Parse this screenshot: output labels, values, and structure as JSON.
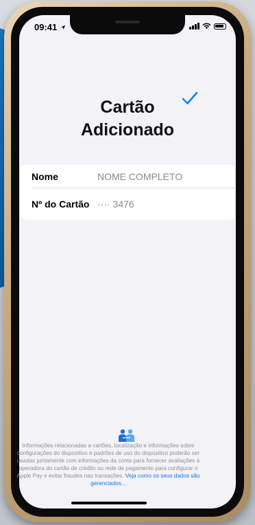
{
  "status_bar": {
    "time": "09:41",
    "icons": [
      "location-arrow-icon",
      "cellular-signal-icon",
      "wifi-icon",
      "battery-icon"
    ]
  },
  "header": {
    "title_line1": "Cartão",
    "title_line2": "Adicionado",
    "accent_color": "#0a84ff"
  },
  "card_details": {
    "name_label": "Nome",
    "name_value": "NOME COMPLETO",
    "number_label": "Nº do Cartão",
    "number_value": "···· 3476"
  },
  "privacy": {
    "icon": "handshake-people-icon",
    "text": "Informações relacionadas a cartões, localização e informações sobre configurações do dispositivo e padrões de uso do dispositivo poderão ser usadas juntamente com informações da conta para fornecer avaliações à operadora do cartão de crédito ou rede de pagamento para configurar o Apple Pay e evitar fraudes nas transações.",
    "link": "Veja como os seus dados são gerenciados..."
  }
}
